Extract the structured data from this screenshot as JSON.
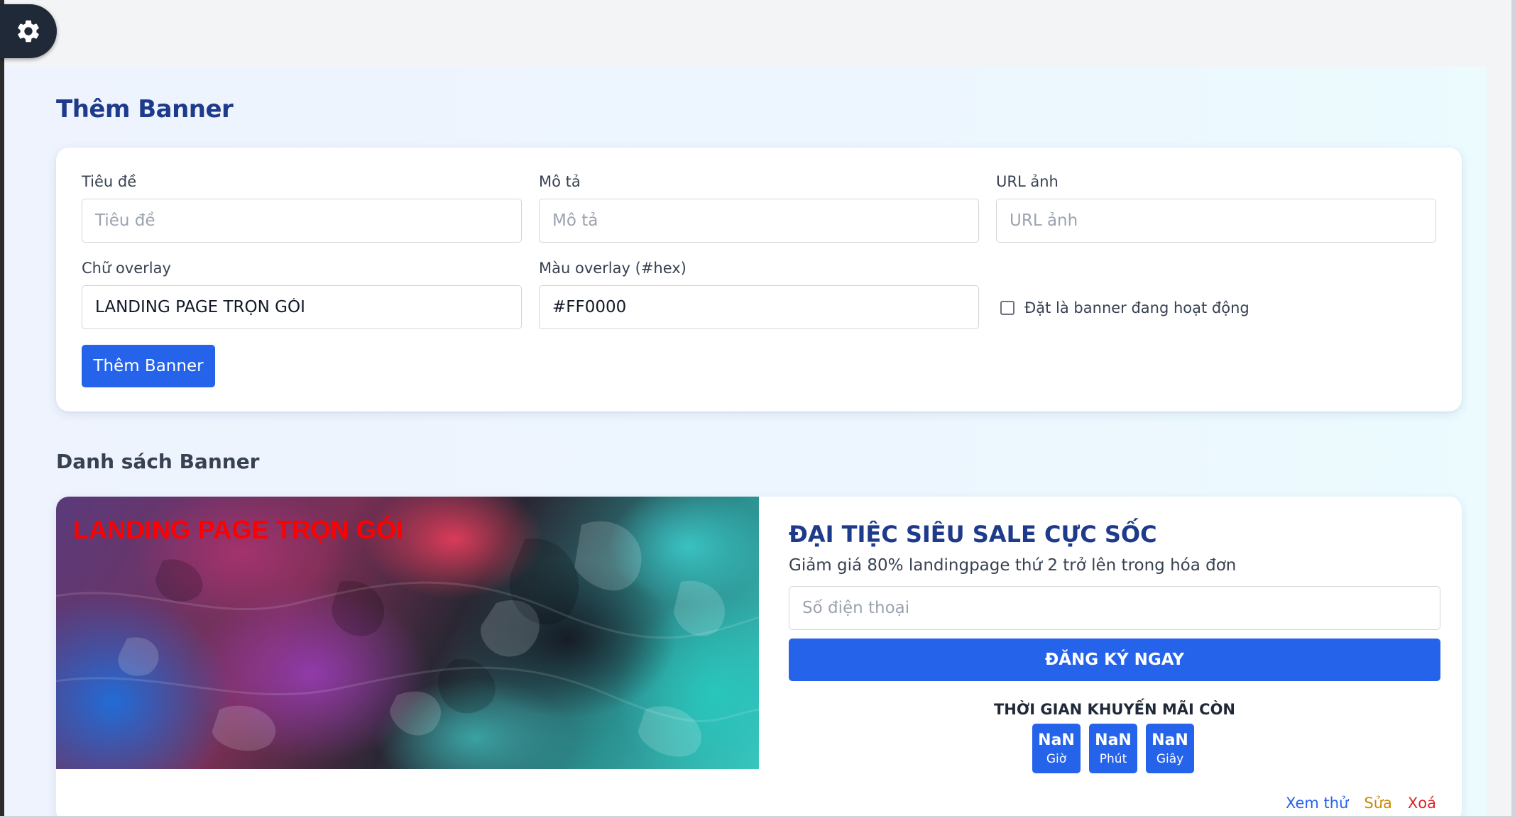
{
  "colors": {
    "primary": "#2563eb",
    "heading": "#1e3a8a",
    "overlay_text": "#FF0000",
    "edit": "#ca8a04",
    "delete": "#dc2626"
  },
  "settings_button": {
    "icon": "gear-icon"
  },
  "page": {
    "title": "Thêm Banner"
  },
  "form": {
    "title_label": "Tiêu đề",
    "title_placeholder": "Tiêu đề",
    "title_value": "",
    "description_label": "Mô tả",
    "description_placeholder": "Mô tả",
    "description_value": "",
    "image_url_label": "URL ảnh",
    "image_url_placeholder": "URL ảnh",
    "image_url_value": "",
    "overlay_text_label": "Chữ overlay",
    "overlay_text_value": "LANDING PAGE TRỌN GÓI",
    "overlay_color_label": "Màu overlay (#hex)",
    "overlay_color_value": "#FF0000",
    "active_checkbox_label": "Đặt là banner đang hoạt động",
    "active_checked": false,
    "submit_label": "Thêm Banner"
  },
  "list": {
    "title": "Danh sách Banner",
    "banners": [
      {
        "overlay_text": "LANDING PAGE TRỌN GÓI",
        "title": "ĐẠI TIỆC SIÊU SALE CỰC SỐC",
        "description": "Giảm giá 80% landingpage thứ 2 trở lên trong hóa đơn",
        "phone_placeholder": "Số điện thoại",
        "register_label": "ĐĂNG KÝ NGAY",
        "countdown_title": "THỜI GIAN KHUYẾN MÃI CÒN",
        "countdown": [
          {
            "value": "NaN",
            "unit": "Giờ"
          },
          {
            "value": "NaN",
            "unit": "Phút"
          },
          {
            "value": "NaN",
            "unit": "Giây"
          }
        ],
        "actions": {
          "preview": "Xem thử",
          "edit": "Sửa",
          "delete": "Xoá"
        }
      }
    ]
  }
}
